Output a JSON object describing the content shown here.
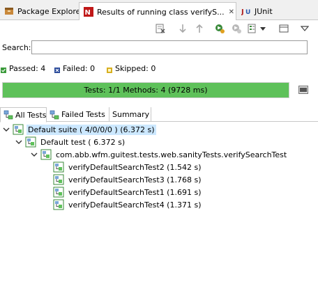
{
  "tabs": [
    {
      "label": "Package Explorer"
    },
    {
      "label": "Results of running class verifyS..."
    },
    {
      "label": "JUnit"
    }
  ],
  "search": {
    "label": "Search:",
    "value": ""
  },
  "counters": {
    "passed": "Passed: 4",
    "failed": "Failed: 0",
    "skipped": "Skipped: 0"
  },
  "progress": {
    "text": "Tests: 1/1  Methods: 4 (9728 ms)",
    "fraction": 1.0
  },
  "subtabs": [
    {
      "label": "All Tests"
    },
    {
      "label": "Failed Tests"
    },
    {
      "label": "Summary"
    }
  ],
  "tree": {
    "suite": "Default suite ( 4/0/0/0 ) (6.372 s)",
    "test": "Default test ( 6.372 s)",
    "class": "com.abb.wfm.guitest.tests.web.sanityTests.verifySearchTest",
    "methods": [
      "verifyDefaultSearchTest2  (1.542 s)",
      "verifyDefaultSearchTest3  (1.768 s)",
      "verifyDefaultSearchTest1  (1.691 s)",
      "verifyDefaultSearchTest4  (1.371 s)"
    ]
  },
  "colors": {
    "progress_green": "#5ec15a",
    "selection": "#cce8ff",
    "passed_green": "#3a9a3a",
    "failed_blue": "#2a4a9a",
    "skipped_yellow": "#d8b020"
  }
}
